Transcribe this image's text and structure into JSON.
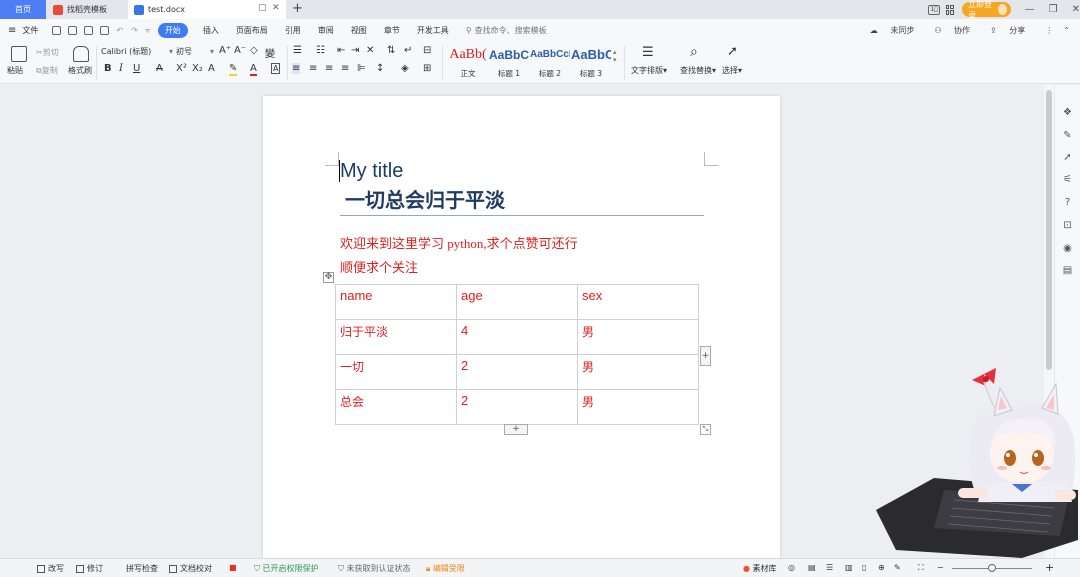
{
  "tabs": {
    "home": "首页",
    "template": "找稻壳模板",
    "document": "test.docx",
    "login": "立即登录"
  },
  "menu": {
    "file": "文件",
    "items": [
      "开始",
      "插入",
      "页面布局",
      "引用",
      "审阅",
      "视图",
      "章节",
      "开发工具"
    ],
    "search_placeholder": "查找命令、搜索模板",
    "unsynced": "未同步",
    "collab": "协作",
    "share": "分享"
  },
  "ribbon": {
    "paste": "粘贴",
    "cut": "剪切",
    "copy": "复制",
    "format_painter": "格式刷",
    "font_name": "Calibri (标题)",
    "font_size": "初号",
    "styles": [
      {
        "sample": "AaBb(",
        "label": "正文"
      },
      {
        "sample": "AaBbCc",
        "label": "标题 1"
      },
      {
        "sample": "AaBbCcI",
        "label": "标题 2"
      },
      {
        "sample": "AaBbC",
        "label": "标题 3"
      }
    ],
    "text_layout": "文字排版",
    "find_replace": "查找替换",
    "select": "选择"
  },
  "document": {
    "title": "My title",
    "subtitle": "一切总会归于平淡",
    "para1": "欢迎来到这里学习 python,求个点赞可还行",
    "para2": "顺便求个关注",
    "table": {
      "headers": [
        "name",
        "age",
        "sex"
      ],
      "rows": [
        [
          "归于平淡",
          "4",
          "男"
        ],
        [
          "一切",
          "2",
          "男"
        ],
        [
          "总会",
          "2",
          "男"
        ]
      ]
    }
  },
  "status": {
    "revise": "改写",
    "track": "修订",
    "spell": "拼写检查",
    "proof": "文档校对",
    "protect": "已开启权限保护",
    "cert": "未获取到认证状态",
    "edit_restrict": "编辑受限",
    "material": "素材库"
  },
  "colors": {
    "accent": "#3e7bf7",
    "doc_text_red": "#e01e1e",
    "title_navy": "#1f3b63",
    "login_orange": "#f5a623"
  }
}
